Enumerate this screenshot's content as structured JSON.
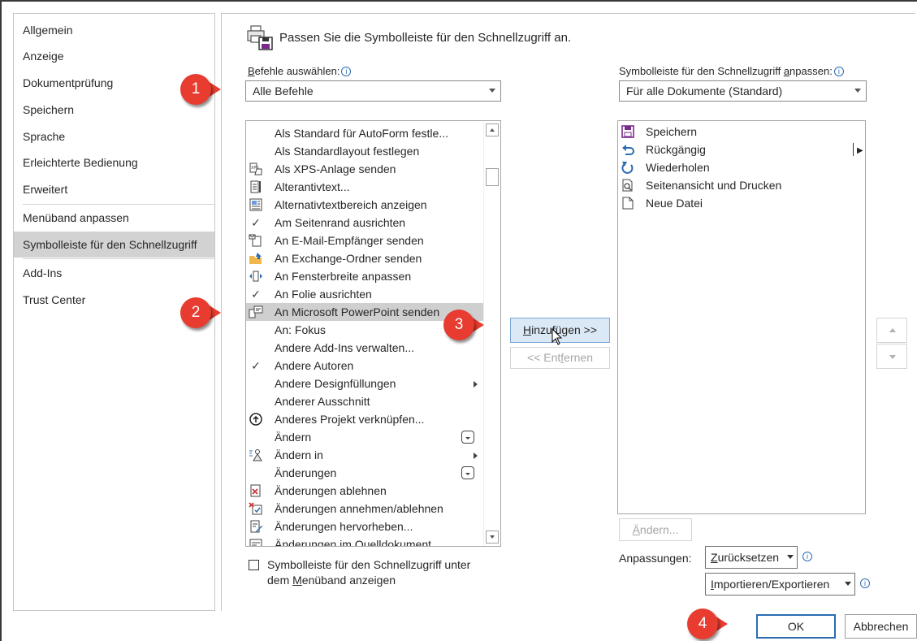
{
  "nav": {
    "items": [
      {
        "label": "Allgemein"
      },
      {
        "label": "Anzeige"
      },
      {
        "label": "Dokumentprüfung"
      },
      {
        "label": "Speichern"
      },
      {
        "label": "Sprache"
      },
      {
        "label": "Erleichterte Bedienung"
      },
      {
        "label": "Erweitert"
      },
      {
        "label": "Menüband anpassen"
      },
      {
        "label": "Symbolleiste für den Schnellzugriff",
        "selected": true
      },
      {
        "label": "Add-Ins"
      },
      {
        "label": "Trust Center"
      }
    ]
  },
  "header": {
    "title": "Passen Sie die Symbolleiste für den Schnellzugriff an."
  },
  "choose": {
    "label_underlined": "B",
    "label_rest": "efehle auswählen:",
    "info": "i",
    "value": "Alle Befehle"
  },
  "customize": {
    "label_prefix": "Symbolleiste für den Schnellzugriff ",
    "label_underlined": "a",
    "label_rest": "npassen:",
    "info": "i",
    "value": "Für alle Dokumente (Standard)"
  },
  "commands": [
    {
      "label": "Als Standard für AutoForm festle...",
      "icon": ""
    },
    {
      "label": "Als Standardlayout festlegen",
      "icon": ""
    },
    {
      "label": "Als XPS-Anlage senden",
      "icon": "xps-attach-icon"
    },
    {
      "label": "Alterantivtext...",
      "icon": "alt-text-icon"
    },
    {
      "label": "Alternativtextbereich anzeigen",
      "icon": "alt-text-pane-icon"
    },
    {
      "label": "Am Seitenrand ausrichten",
      "icon": "check-icon"
    },
    {
      "label": "An E-Mail-Empfänger senden",
      "icon": "email-send-icon"
    },
    {
      "label": "An Exchange-Ordner senden",
      "icon": "exchange-folder-icon"
    },
    {
      "label": "An Fensterbreite anpassen",
      "icon": "fit-width-icon"
    },
    {
      "label": "An Folie ausrichten",
      "icon": "check-icon"
    },
    {
      "label": "An Microsoft PowerPoint senden",
      "icon": "powerpoint-send-icon",
      "selected": true
    },
    {
      "label": "An: Fokus",
      "icon": ""
    },
    {
      "label": "Andere Add-Ins verwalten...",
      "icon": ""
    },
    {
      "label": "Andere Autoren",
      "icon": "check-icon"
    },
    {
      "label": "Andere Designfüllungen",
      "icon": "",
      "submenu": true
    },
    {
      "label": "Anderer Ausschnitt",
      "icon": ""
    },
    {
      "label": "Anderes Projekt verknüpfen...",
      "icon": "link-project-icon"
    },
    {
      "label": "Ändern",
      "icon": "",
      "dropdown": true
    },
    {
      "label": "Ändern in",
      "icon": "change-to-icon",
      "submenu": true
    },
    {
      "label": "Änderungen",
      "icon": "",
      "dropdown": true
    },
    {
      "label": "Änderungen ablehnen",
      "icon": "reject-changes-icon"
    },
    {
      "label": "Änderungen annehmen/ablehnen",
      "icon": "accept-reject-icon"
    },
    {
      "label": "Änderungen hervorheben...",
      "icon": "highlight-changes-icon"
    },
    {
      "label": "Änderungen im Quelldokument ...",
      "icon": "source-changes-icon"
    }
  ],
  "qat_items": [
    {
      "label": "Speichern",
      "icon": "save-icon"
    },
    {
      "label": "Rückgängig",
      "icon": "undo-icon",
      "separator_submenu": true
    },
    {
      "label": "Wiederholen",
      "icon": "redo-icon"
    },
    {
      "label": "Seitenansicht und Drucken",
      "icon": "print-preview-icon"
    },
    {
      "label": "Neue Datei",
      "icon": "new-file-icon"
    }
  ],
  "buttons": {
    "add_underlined": "H",
    "add_rest": "inzufügen >>",
    "remove_prefix": "<< Ent",
    "remove_underlined": "f",
    "remove_rest": "ernen",
    "modify_underlined": "Ä",
    "modify_rest": "ndern...",
    "reset_underlined": "Z",
    "reset_rest": "urücksetzen",
    "import_underlined": "I",
    "import_rest": "mportieren/Exportieren",
    "ok": "OK",
    "cancel": "Abbrechen"
  },
  "customizations_label": "Anpassungen:",
  "show_below": {
    "line1": "Symbolleiste für den Schnellzugriff unter",
    "line2_prefix": "dem ",
    "line2_underlined": "M",
    "line2_rest": "enüband anzeigen",
    "checked": false
  },
  "callouts": [
    "1",
    "2",
    "3",
    "4"
  ],
  "colors": {
    "callout": "#e73c2f",
    "accent": "#2b6cb3",
    "selected": "#d2d2d2",
    "add_button": "#dbe8f6"
  }
}
